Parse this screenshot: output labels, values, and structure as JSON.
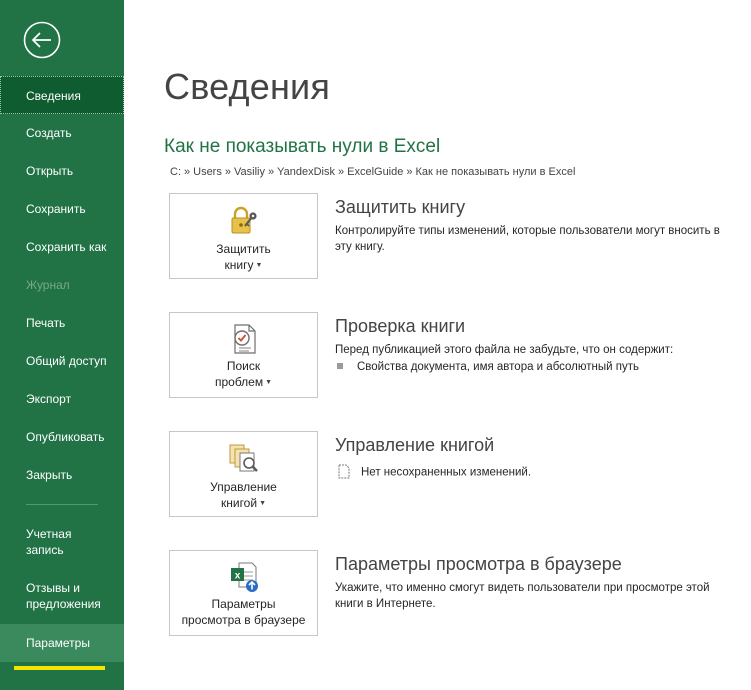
{
  "sidebar": {
    "items": [
      {
        "label": "Сведения"
      },
      {
        "label": "Создать"
      },
      {
        "label": "Открыть"
      },
      {
        "label": "Сохранить"
      },
      {
        "label": "Сохранить как"
      },
      {
        "label": "Журнал"
      },
      {
        "label": "Печать"
      },
      {
        "label": "Общий доступ"
      },
      {
        "label": "Экспорт"
      },
      {
        "label": "Опубликовать"
      },
      {
        "label": "Закрыть"
      },
      {
        "label_line1": "Учетная",
        "label_line2": "запись"
      },
      {
        "label_line1": "Отзывы и",
        "label_line2": "предложения"
      },
      {
        "label": "Параметры"
      }
    ],
    "active_index": 0,
    "disabled_index": 5,
    "highlight_color": "#f5e400"
  },
  "main": {
    "title": "Сведения",
    "doc_title": "Как не показывать нули в Excel",
    "breadcrumb": [
      "C:",
      "Users",
      "Vasiliy",
      "YandexDisk",
      "ExcelGuide",
      "Как не показывать нули в Excel"
    ],
    "breadcrumb_sep": "»",
    "sections": [
      {
        "button_line1": "Защитить",
        "button_line2": "книгу",
        "heading": "Защитить книгу",
        "description": "Контролируйте типы изменений, которые пользователи могут вносить в эту книгу."
      },
      {
        "button_line1": "Поиск",
        "button_line2": "проблем",
        "heading": "Проверка книги",
        "description": "Перед публикацией этого файла не забудьте, что он содержит:",
        "bullet": "Свойства документа, имя автора и абсолютный путь"
      },
      {
        "button_line1": "Управление",
        "button_line2": "книгой",
        "heading": "Управление книгой",
        "bullet": "Нет несохраненных изменений."
      },
      {
        "button_line1": "Параметры",
        "button_line2": "просмотра в браузере",
        "heading": "Параметры просмотра в браузере",
        "description": "Укажите, что именно смогут видеть пользователи при просмотре этой книги в Интернете."
      }
    ]
  },
  "colors": {
    "brand": "#217346",
    "active_item": "#0e5c2f",
    "doc_title": "#217346"
  },
  "icons": {
    "back": "back-arrow-icon",
    "protect": "lock-key-icon",
    "inspect": "inspect-document-icon",
    "manage": "manage-workbook-icon",
    "browser": "excel-browser-view-icon"
  }
}
